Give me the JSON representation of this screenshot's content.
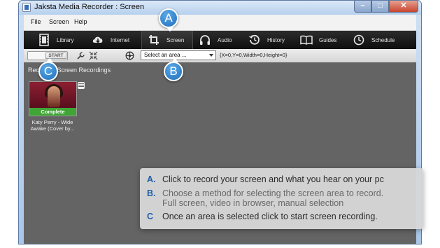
{
  "window": {
    "title": "Jaksta Media Recorder : Screen",
    "controls": {
      "minimize": "–",
      "maximize": "□",
      "close": "✕"
    }
  },
  "menu": {
    "file": "File",
    "screen": "Screen",
    "help": "Help"
  },
  "nav": {
    "library": {
      "label": "Library",
      "icon": "film-icon"
    },
    "internet": {
      "label": "Internet",
      "icon": "cloud-download-icon"
    },
    "screen": {
      "label": "Screen",
      "icon": "crop-icon"
    },
    "audio": {
      "label": "Audio",
      "icon": "headphones-icon"
    },
    "history": {
      "label": "History",
      "icon": "history-icon"
    },
    "guides": {
      "label": "Guides",
      "icon": "book-icon"
    },
    "schedule": {
      "label": "Schedule",
      "icon": "clock-icon"
    }
  },
  "toolbar": {
    "start_label": "START",
    "select_value": "Select an area ...",
    "coords": "{X=0,Y=0,Width=0,Height=0}"
  },
  "content": {
    "section_title": "Recorded Screen Recordings",
    "recording": {
      "status": "Complete",
      "caption_line1": "Katy Perry - Wide",
      "caption_line2": "Awake (Cover by..."
    }
  },
  "callouts": {
    "a": "A",
    "b": "B",
    "c": "C"
  },
  "info": {
    "a_letter": "A.",
    "a_text": "Click to record your screen and what you hear on your pc",
    "b_letter": "B.",
    "b_text_line1": "Choose a method for selecting the screen area to record.",
    "b_text_line2": "Full screen, video in browser, manual selection",
    "c_letter": "C",
    "c_text": "Once an area is selected click to start screen recording."
  },
  "colors": {
    "nav_bg": "#1a1a1a",
    "content_bg": "#646464",
    "callout_blue": "#2e7fcf",
    "complete_green": "#3fa535",
    "info_letter_blue": "#1f5fa8"
  }
}
